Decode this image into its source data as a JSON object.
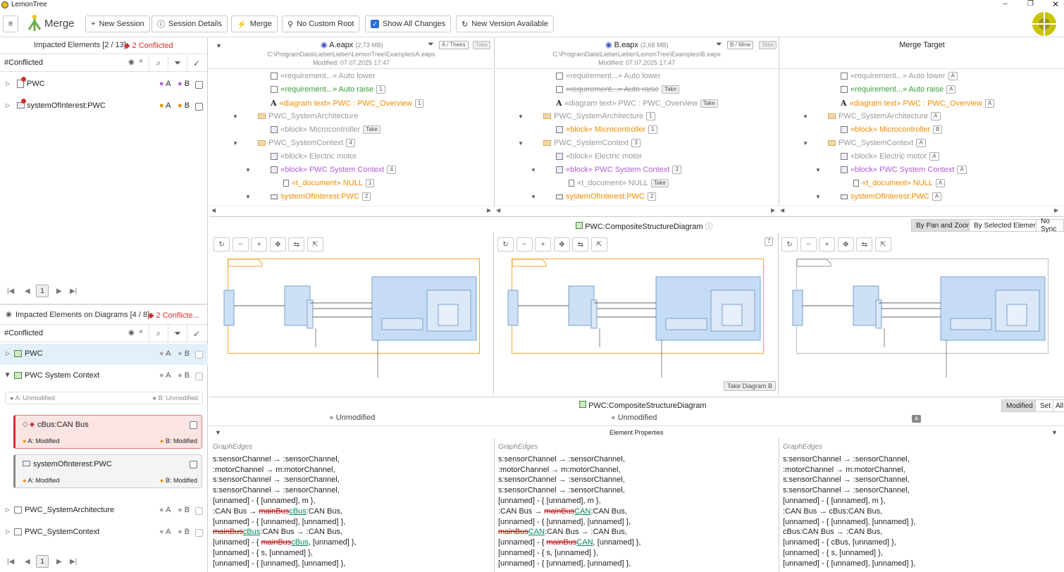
{
  "app": {
    "title": "LemonTree",
    "mode": "Merge"
  },
  "toolbar": {
    "new_session": "New Session",
    "session_details": "Session Details",
    "merge": "Merge",
    "no_custom_root": "No Custom Root",
    "show_all_changes": "Show All Changes",
    "new_version": "New Version Available"
  },
  "left": {
    "impacted_title": "Impacted Elements [2 / 13]",
    "impacted_conflicts": "2 Conflicted",
    "filter": "#Conflicted",
    "items": [
      {
        "label": "PWC",
        "a": "A",
        "b": "B"
      },
      {
        "label": "systemOfInterest:PWC",
        "a": "A",
        "b": "B"
      }
    ],
    "page": "1",
    "diag_title": "Impacted Elements on Diagrams [4 / 8]",
    "diag_conflicts": "2 Conflicte...",
    "diag_filter": "#Conflicted",
    "diag_items": [
      {
        "label": "PWC",
        "a": "A",
        "b": "B"
      },
      {
        "label": "PWC System Context",
        "a": "A",
        "b": "B"
      }
    ],
    "mod_a": "A: Unmodified",
    "mod_b": "B: Unmodified",
    "cards": [
      {
        "label": "cBus:CAN Bus",
        "a": "A: Modified",
        "b": "B: Modified"
      },
      {
        "label": "systemOfInterest:PWC",
        "a": "A: Modified",
        "b": "B: Modified"
      }
    ],
    "diag_items2": [
      {
        "label": "PWC_SystemArchitecture",
        "a": "A",
        "b": "B"
      },
      {
        "label": "PWC_SystemContext",
        "a": "A",
        "b": "B"
      }
    ],
    "page2": "1"
  },
  "cols": [
    {
      "file": "A.eapx",
      "size": "(2,73 MB)",
      "tag": "A / Theirs",
      "take": "Take",
      "path": "C:\\ProgramData\\LieberLieber\\LemonTree\\Examples\\A.eapx",
      "modified": "Modified: 07.07.2025 17:47"
    },
    {
      "file": "B.eapx",
      "size": "(2,68 MB)",
      "tag": "B / Mine",
      "take": "Take",
      "path": "C:\\ProgramData\\LieberLieber\\LemonTree\\Examples\\B.eapx",
      "modified": "Modified: 07.07.2025 17:47"
    },
    {
      "title": "Merge Target"
    }
  ],
  "tree": {
    "a": [
      {
        "t": "«requirement...» Auto lower",
        "c": "grey",
        "b": ""
      },
      {
        "t": "«requirement...» Auto raise",
        "c": "green",
        "b": "1"
      },
      {
        "t": "«diagram text» PWC : PWC_Overview",
        "c": "orange",
        "b": "1"
      },
      {
        "t": "PWC_SystemArchitecture",
        "c": "grey",
        "b": ""
      },
      {
        "t": "«block» Microcontroller",
        "c": "grey",
        "b": "Take"
      },
      {
        "t": "PWC_SystemContext",
        "c": "grey",
        "b": "4"
      },
      {
        "t": "«block» Electric motor",
        "c": "grey",
        "b": ""
      },
      {
        "t": "«block» PWC System Context",
        "c": "purple",
        "b": "4"
      },
      {
        "t": "«t_document» NULL",
        "c": "orange",
        "b": "1"
      },
      {
        "t": "systemOfInterest:PWC",
        "c": "orange",
        "b": "2"
      }
    ],
    "b": [
      {
        "t": "«requirement...» Auto lower",
        "c": "grey",
        "b": ""
      },
      {
        "t": "«requirement...» Auto raise",
        "c": "grey",
        "b": "Take"
      },
      {
        "t": "«diagram text» PWC : PWC_Overview",
        "c": "grey",
        "b": "Take"
      },
      {
        "t": "PWC_SystemArchitecture",
        "c": "grey",
        "b": "1"
      },
      {
        "t": "«block» Microcontroller",
        "c": "orange",
        "b": "1"
      },
      {
        "t": "PWC_SystemContext",
        "c": "grey",
        "b": "3"
      },
      {
        "t": "«block» Electric motor",
        "c": "grey",
        "b": ""
      },
      {
        "t": "«block» PWC System Context",
        "c": "purple",
        "b": "3"
      },
      {
        "t": "«t_document» NULL",
        "c": "grey",
        "b": "Take"
      },
      {
        "t": "systemOfInterest:PWC",
        "c": "orange",
        "b": "2"
      }
    ],
    "m": [
      {
        "t": "«requirement...» Auto lower",
        "c": "grey",
        "b": "A"
      },
      {
        "t": "«requirement...» Auto raise",
        "c": "green",
        "b": "A"
      },
      {
        "t": "«diagram text» PWC : PWC_Overview",
        "c": "orange",
        "b": "A"
      },
      {
        "t": "PWC_SystemArchitecture",
        "c": "grey",
        "b": "A"
      },
      {
        "t": "«block» Microcontroller",
        "c": "orange",
        "b": "B"
      },
      {
        "t": "PWC_SystemContext",
        "c": "grey",
        "b": "A"
      },
      {
        "t": "«block» Electric motor",
        "c": "grey",
        "b": "A"
      },
      {
        "t": "«block» PWC System Context",
        "c": "purple",
        "b": "A"
      },
      {
        "t": "«t_document» NULL",
        "c": "orange",
        "b": "A"
      },
      {
        "t": "systemOfInterest:PWC",
        "c": "orange",
        "b": "A"
      }
    ]
  },
  "diagram": {
    "title": "PWC:CompositeStructureDiagram",
    "sync": [
      "By Pan and Zoom",
      "By Selected Element",
      "No Sync"
    ],
    "count": "7",
    "take": "Take Diagram B"
  },
  "props": {
    "title": "PWC:CompositeStructureDiagram",
    "status_a": "Unmodified",
    "status_b": "Unmodified",
    "status_m": "A",
    "section": "Element Properties",
    "filters": [
      "Modified",
      "Set",
      "All"
    ],
    "group": "GraphEdges"
  }
}
